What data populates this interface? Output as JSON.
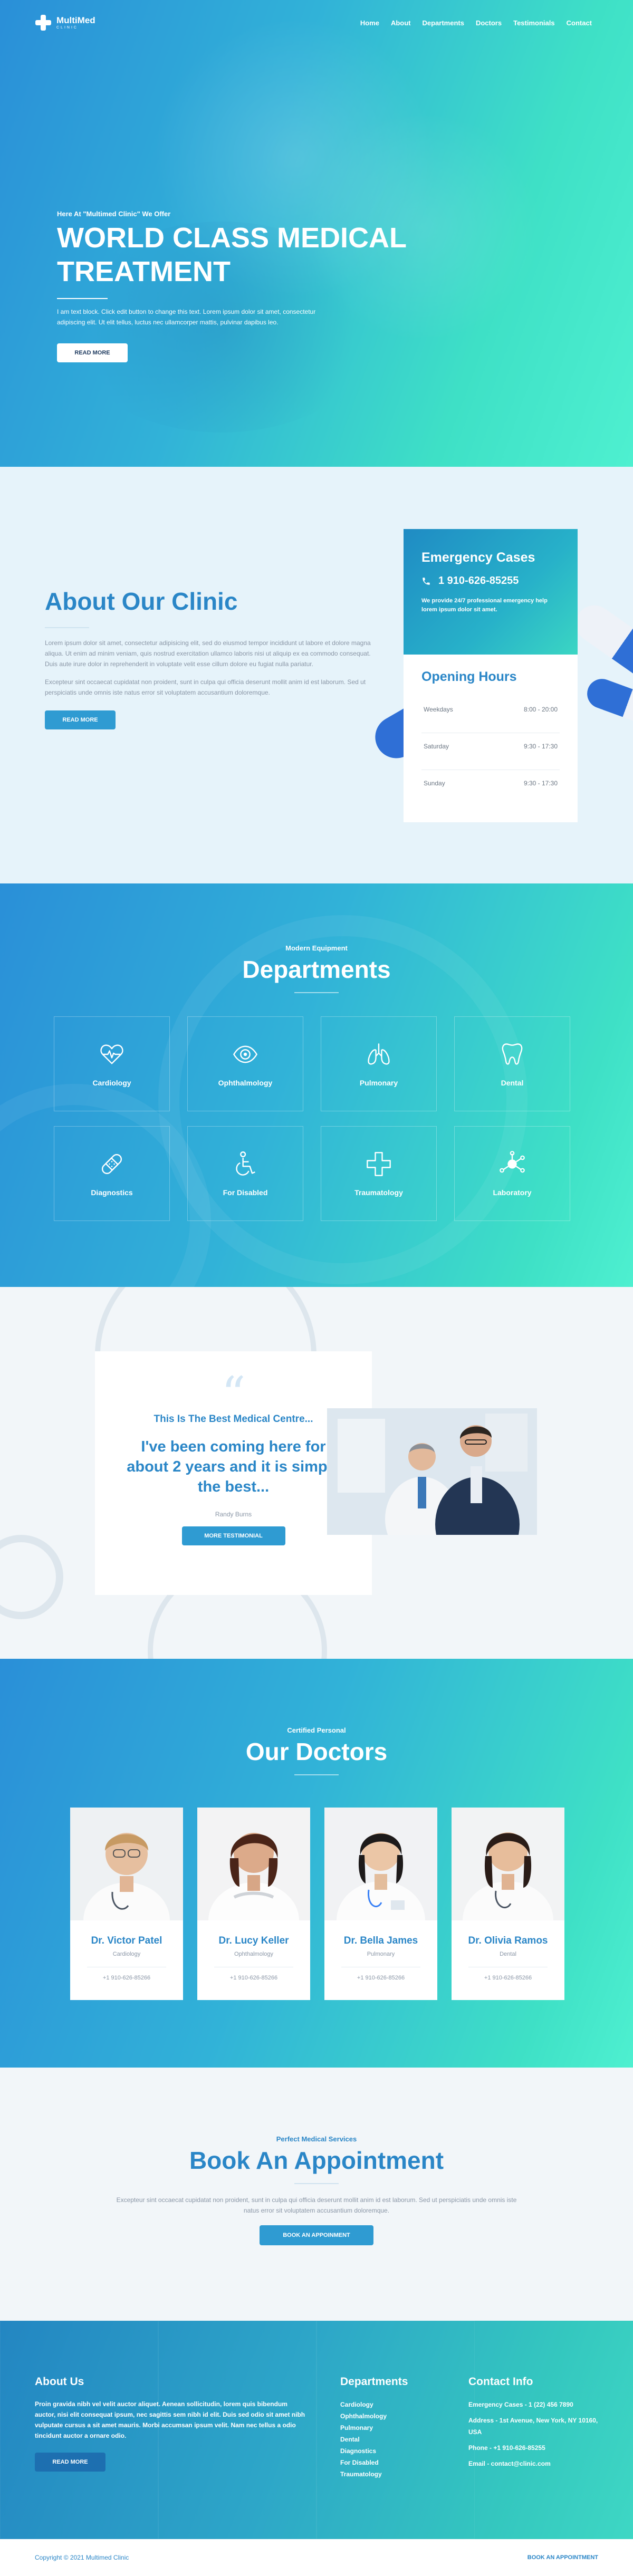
{
  "brand": {
    "name": "MultiMed",
    "sub": "CLINIC"
  },
  "nav": {
    "items": [
      "Home",
      "About",
      "Departments",
      "Doctors",
      "Testimonials",
      "Contact"
    ]
  },
  "hero": {
    "kicker": "Here At \"Multimed Clinic\" We Offer",
    "title": "WORLD CLASS MEDICAL TREATMENT",
    "description": "I am text block. Click edit button to change this text. Lorem ipsum dolor sit amet, consectetur adipiscing elit. Ut elit tellus, luctus nec ullamcorper mattis, pulvinar dapibus leo.",
    "button": "READ MORE"
  },
  "about": {
    "title": "About Our Clinic",
    "p1": "Lorem ipsum dolor sit amet, consectetur adipisicing elit, sed do eiusmod tempor incididunt ut labore et dolore magna aliqua. Ut enim ad minim veniam, quis nostrud exercitation ullamco laboris nisi ut aliquip ex ea commodo consequat. Duis aute irure dolor in reprehenderit in voluptate velit esse cillum dolore eu fugiat nulla pariatur.",
    "p2": "Excepteur sint occaecat cupidatat non proident, sunt in culpa qui officia deserunt mollit anim id est laborum. Sed ut perspiciatis unde omnis iste natus error sit voluptatem accusantium doloremque.",
    "button": "READ MORE"
  },
  "emergency": {
    "title": "Emergency Cases",
    "phone": "1 910-626-85255",
    "text": "We provide 24/7 professional emergency help lorem ipsum dolor sit amet."
  },
  "hours": {
    "title": "Opening Hours",
    "rows": [
      {
        "day": "Weekdays",
        "time": "8:00 - 20:00"
      },
      {
        "day": "Saturday",
        "time": "9:30 - 17:30"
      },
      {
        "day": "Sunday",
        "time": "9:30 - 17:30"
      }
    ]
  },
  "departments": {
    "kicker": "Modern Equipment",
    "title": "Departments",
    "items": [
      {
        "label": "Cardiology",
        "icon": "heartbeat-icon"
      },
      {
        "label": "Ophthalmology",
        "icon": "eye-icon"
      },
      {
        "label": "Pulmonary",
        "icon": "lungs-icon"
      },
      {
        "label": "Dental",
        "icon": "tooth-icon"
      },
      {
        "label": "Diagnostics",
        "icon": "bandage-icon"
      },
      {
        "label": "For Disabled",
        "icon": "wheelchair-icon"
      },
      {
        "label": "Traumatology",
        "icon": "medical-cross-icon"
      },
      {
        "label": "Laboratory",
        "icon": "molecule-icon"
      }
    ]
  },
  "testimonial": {
    "kicker": "This Is The Best Medical Centre...",
    "quote": "I've been coming here for about 2 years and it is simply the best...",
    "author": "Randy Burns",
    "button": "MORE TESTIMONIAL"
  },
  "doctors": {
    "kicker": "Certified Personal",
    "title": "Our Doctors",
    "items": [
      {
        "name": "Dr. Victor Patel",
        "specialty": "Cardiology",
        "phone": "+1 910-626-85266"
      },
      {
        "name": "Dr. Lucy Keller",
        "specialty": "Ophthalmology",
        "phone": "+1 910-626-85266"
      },
      {
        "name": "Dr. Bella James",
        "specialty": "Pulmonary",
        "phone": "+1 910-626-85266"
      },
      {
        "name": "Dr. Olivia Ramos",
        "specialty": "Dental",
        "phone": "+1 910-626-85266"
      }
    ]
  },
  "book": {
    "kicker": "Perfect Medical Services",
    "title": "Book An Appointment",
    "text": "Excepteur sint occaecat cupidatat non proident, sunt in culpa qui officia deserunt mollit anim id est laborum. Sed ut perspiciatis unde omnis iste natus error sit voluptatem accusantium doloremque.",
    "button": "BOOK AN APPOINMENT"
  },
  "footer": {
    "about_title": "About Us",
    "about_text": "Proin gravida nibh vel velit auctor aliquet. Aenean sollicitudin, lorem quis bibendum auctor, nisi elit consequat ipsum, nec sagittis sem nibh id elit. Duis sed odio sit amet nibh vulputate cursus a sit amet mauris. Morbi accumsan ipsum velit. Nam nec tellus a odio tincidunt auctor a ornare odio.",
    "about_button": "READ MORE",
    "dept_title": "Departments",
    "dept_list": [
      "Cardiology",
      "Ophthalmology",
      "Pulmonary",
      "Dental",
      "Diagnostics",
      "For Disabled",
      "Traumatology"
    ],
    "contact_title": "Contact Info",
    "contact_list": [
      "Emergency Cases - 1 (22) 456 7890",
      "Address - 1st Avenue, New York, NY 10160, USA",
      "Phone - +1 910-626-85255",
      "Email - contact@clinic.com"
    ],
    "copyright": "Copyright © 2021 Multimed Clinic",
    "bottom_link": "BOOK AN APPOINTMENT"
  },
  "colors": {
    "primary": "#2a86c7",
    "gradient_start": "#2a8fd8",
    "gradient_end": "#4ef0d0"
  }
}
